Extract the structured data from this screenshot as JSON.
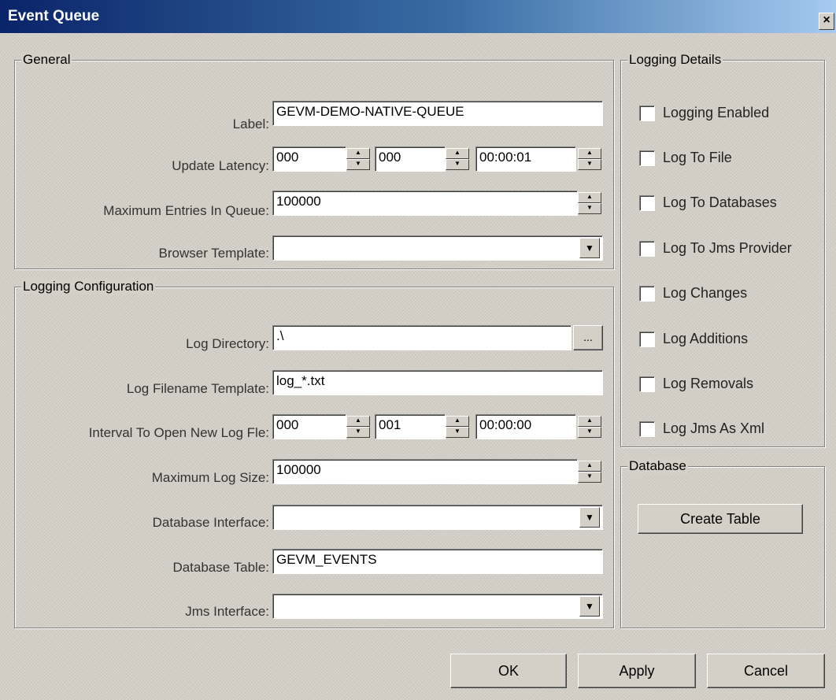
{
  "window": {
    "title": "Event Queue",
    "close_glyph": "×"
  },
  "general": {
    "title": "General",
    "label_label": "Label:",
    "label_value": "GEVM-DEMO-NATIVE-QUEUE",
    "update_latency_label": "Update Latency:",
    "update_latency": [
      "000",
      "000",
      "00:00:01"
    ],
    "max_entries_label": "Maximum Entries In Queue:",
    "max_entries_value": "100000",
    "browser_template_label": "Browser Template:",
    "browser_template_value": ""
  },
  "logging_config": {
    "title": "Logging Configuration",
    "log_directory_label": "Log Directory:",
    "log_directory_value": ".\\",
    "browse_label": "...",
    "log_filename_label": "Log Filename Template:",
    "log_filename_value": "log_*.txt",
    "interval_label": "Interval To Open New Log Fle:",
    "interval": [
      "000",
      "001",
      "00:00:00"
    ],
    "max_log_size_label": "Maximum Log Size:",
    "max_log_size_value": "100000",
    "db_interface_label": "Database Interface:",
    "db_interface_value": "",
    "db_table_label": "Database Table:",
    "db_table_value": "GEVM_EVENTS",
    "jms_interface_label": "Jms Interface:",
    "jms_interface_value": ""
  },
  "logging_details": {
    "title": "Logging Details",
    "items": [
      {
        "label": "Logging Enabled",
        "checked": false
      },
      {
        "label": "Log To File",
        "checked": false
      },
      {
        "label": "Log To Databases",
        "checked": false
      },
      {
        "label": "Log To Jms Provider",
        "checked": false
      },
      {
        "label": "Log Changes",
        "checked": false
      },
      {
        "label": "Log Additions",
        "checked": false
      },
      {
        "label": "Log Removals",
        "checked": false
      },
      {
        "label": "Log Jms As Xml",
        "checked": false
      }
    ]
  },
  "database": {
    "title": "Database",
    "create_table_label": "Create Table"
  },
  "buttons": {
    "ok": "OK",
    "apply": "Apply",
    "cancel": "Cancel"
  },
  "icons": {
    "spin_up": "▲",
    "spin_down": "▼",
    "dropdown": "▼"
  }
}
